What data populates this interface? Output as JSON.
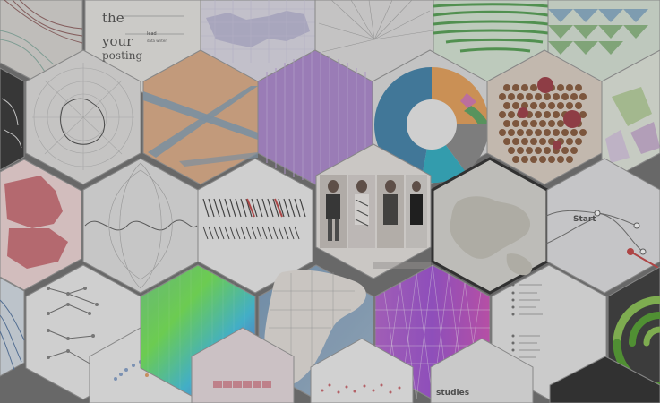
{
  "words": {
    "the": "the",
    "your": "your",
    "posting": "posting",
    "start": "Start",
    "studies": "studies"
  },
  "colors": {
    "background": "#777777",
    "hex_border": "#9a9a9a",
    "globe_border": "#383838",
    "donut_blue": "#4b88ad",
    "donut_cyan": "#3bb2c5",
    "donut_orange": "#e6a461",
    "donut_green": "#65a86a",
    "lavender": "#b08ed0",
    "peach": "#ddb08c",
    "green_stripes": "#5da45c",
    "dark_tile": "#4a4a4a",
    "red_map": "#c5616a",
    "ocean": "#8dacc7"
  },
  "icons": [
    "curve-lines-icon",
    "stacked-bars-icon",
    "globe-icon",
    "donut-chart-icon",
    "bubble-grid-icon",
    "photo-gallery-icon",
    "color-gradient-icon",
    "tree-diagram-icon",
    "concentric-arcs-icon"
  ]
}
